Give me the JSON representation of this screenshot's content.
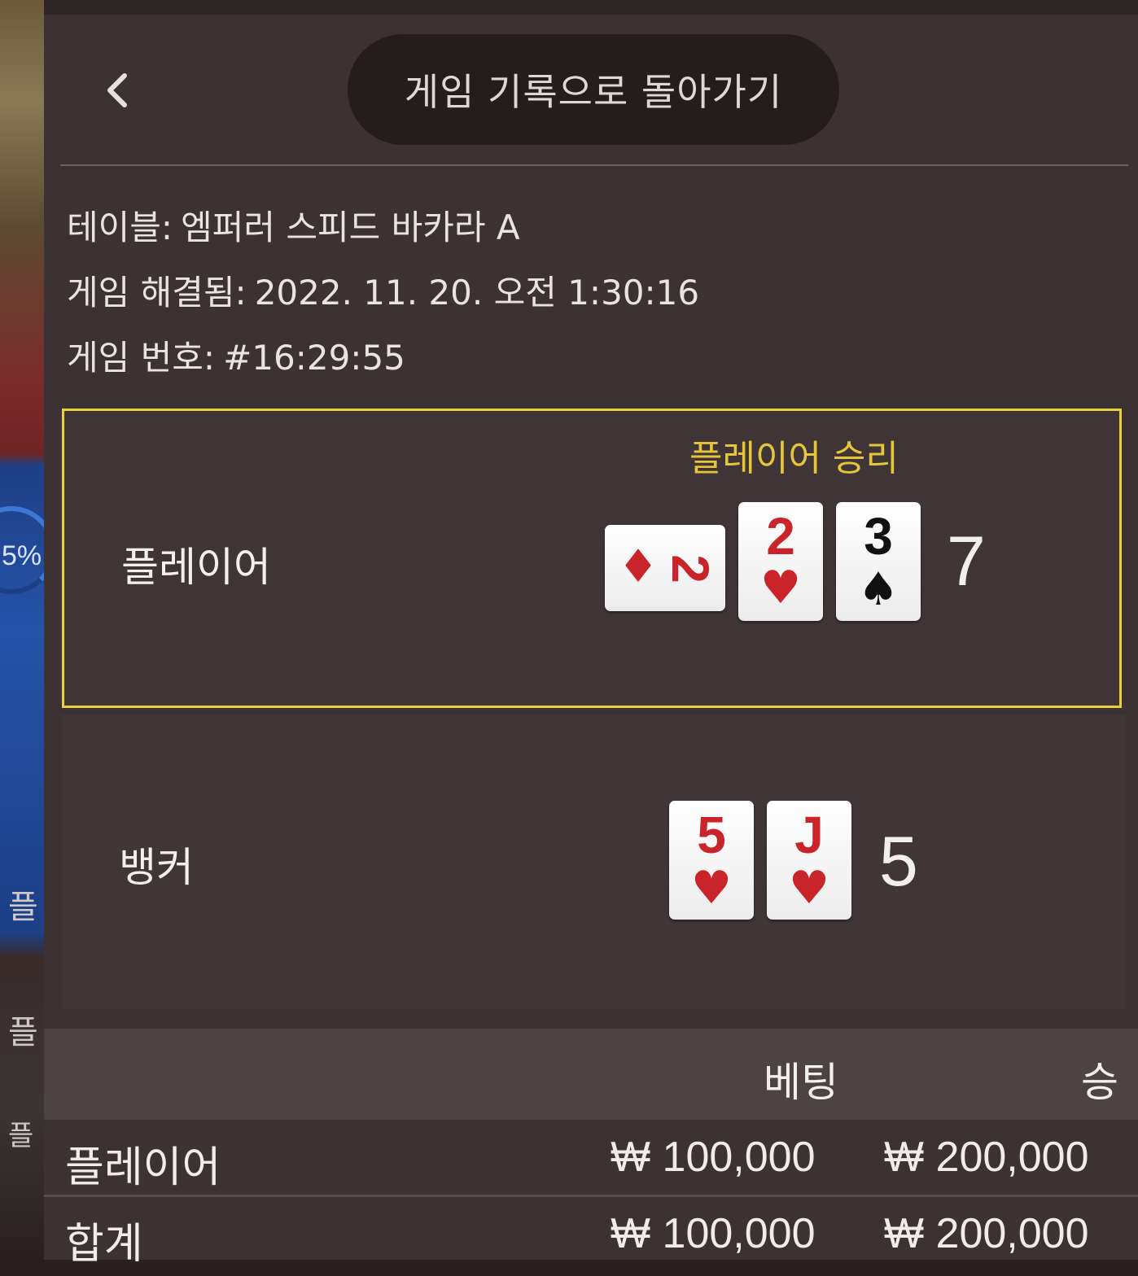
{
  "background": {
    "percent_text": "5%",
    "ghost_text_1": "플",
    "ghost_text_2": "플",
    "ghost_text_3": "플"
  },
  "header": {
    "back_icon": "chevron-left-icon",
    "title": "게임 기록으로 돌아가기"
  },
  "info": {
    "table_label": "테이블:",
    "table_value": "엠퍼러 스피드 바카라 A",
    "resolved_label": "게임 해결됨:",
    "resolved_value": "2022. 11. 20. 오전 1:30:16",
    "number_label": "게임 번호:",
    "number_value": "#16:29:55"
  },
  "player": {
    "label": "플레이어",
    "result": "플레이어 승리",
    "total": "7",
    "cards": [
      {
        "rank": "2",
        "suit": "♦",
        "color": "#c8242a",
        "orientation": "sideways"
      },
      {
        "rank": "2",
        "suit": "♥",
        "color": "#c8242a",
        "orientation": "upright"
      },
      {
        "rank": "3",
        "suit": "♠",
        "color": "#111111",
        "orientation": "upright"
      }
    ]
  },
  "banker": {
    "label": "뱅커",
    "total": "5",
    "cards": [
      {
        "rank": "5",
        "suit": "♥",
        "color": "#c8242a"
      },
      {
        "rank": "J",
        "suit": "♥",
        "color": "#c8242a"
      }
    ]
  },
  "bets": {
    "col_bet": "베팅",
    "col_win": "승",
    "rows": [
      {
        "name": "플레이어",
        "bet": "₩ 100,000",
        "win": "₩ 200,000"
      },
      {
        "name": "합계",
        "bet": "₩ 100,000",
        "win": "₩ 200,000"
      }
    ]
  },
  "colors": {
    "panel": "#3c3233",
    "highlight_border": "#e8d13a",
    "win_text": "#e5c63a",
    "card_red": "#c8242a"
  }
}
